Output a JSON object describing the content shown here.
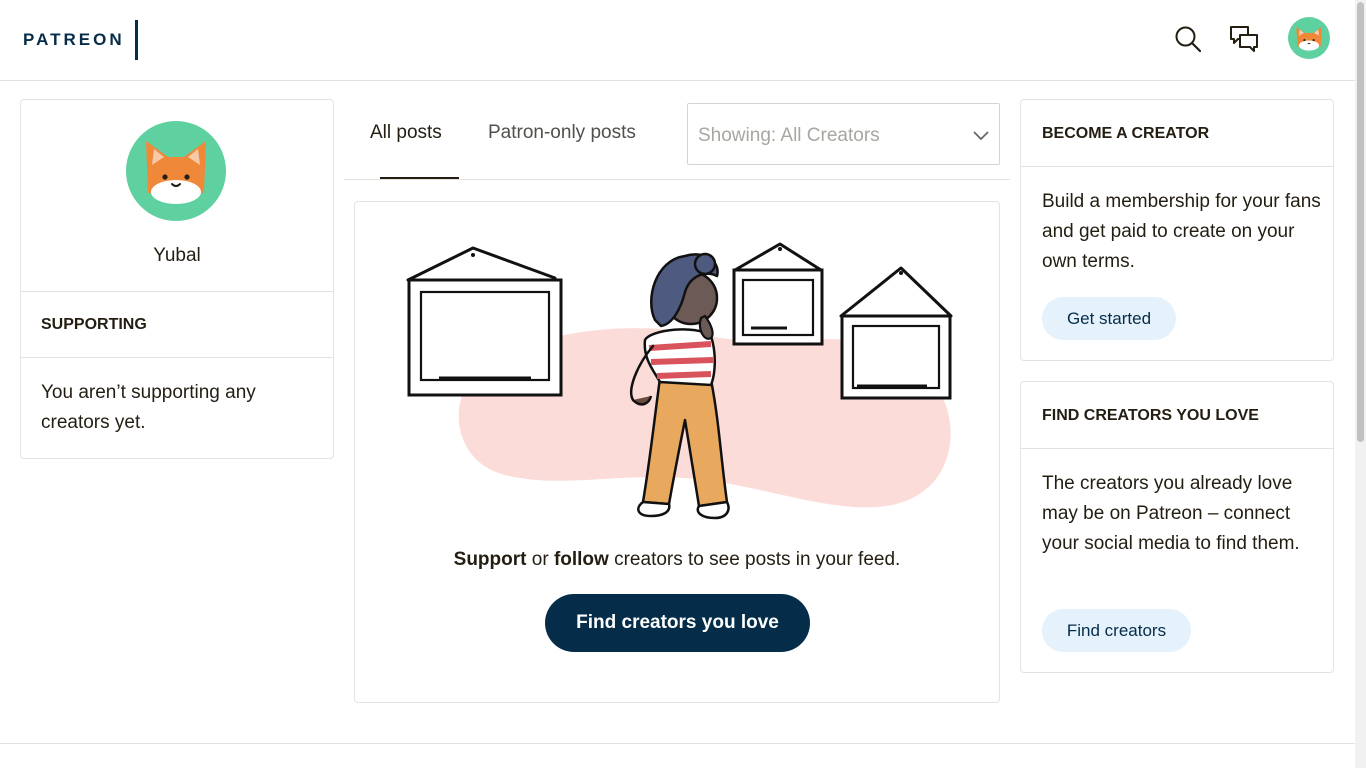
{
  "header": {
    "logo": "PATREON",
    "icons": {
      "search": "search-icon",
      "messages": "chat-bubbles-icon",
      "avatar": "fox-avatar"
    }
  },
  "profile": {
    "name": "Yubal",
    "supporting_title": "SUPPORTING",
    "supporting_text": "You aren’t supporting any creators yet."
  },
  "feed": {
    "tabs": [
      {
        "label": "All posts",
        "active": true
      },
      {
        "label": "Patron-only posts",
        "active": false
      }
    ],
    "filter": {
      "selected": "Showing: All Creators"
    },
    "message": {
      "support": "Support",
      "or": " or ",
      "follow": "follow",
      "rest": " creators to see posts in your feed."
    },
    "cta_label": "Find creators you love"
  },
  "become_creator": {
    "title": "BECOME A CREATOR",
    "text": "Build a membership for your fans and get paid to create on your own terms.",
    "button": "Get started"
  },
  "find_creators": {
    "title": "FIND CREATORS YOU LOVE",
    "text": "The creators you already love may be on Patreon – connect your social media to find them.",
    "button": "Find creators"
  },
  "colors": {
    "brand_navy": "#052d49",
    "pill_bg": "#e5f1fb",
    "avatar_green": "#5fd0a0",
    "fox_orange": "#f0883a",
    "blob_pink": "#fbdcd9"
  }
}
